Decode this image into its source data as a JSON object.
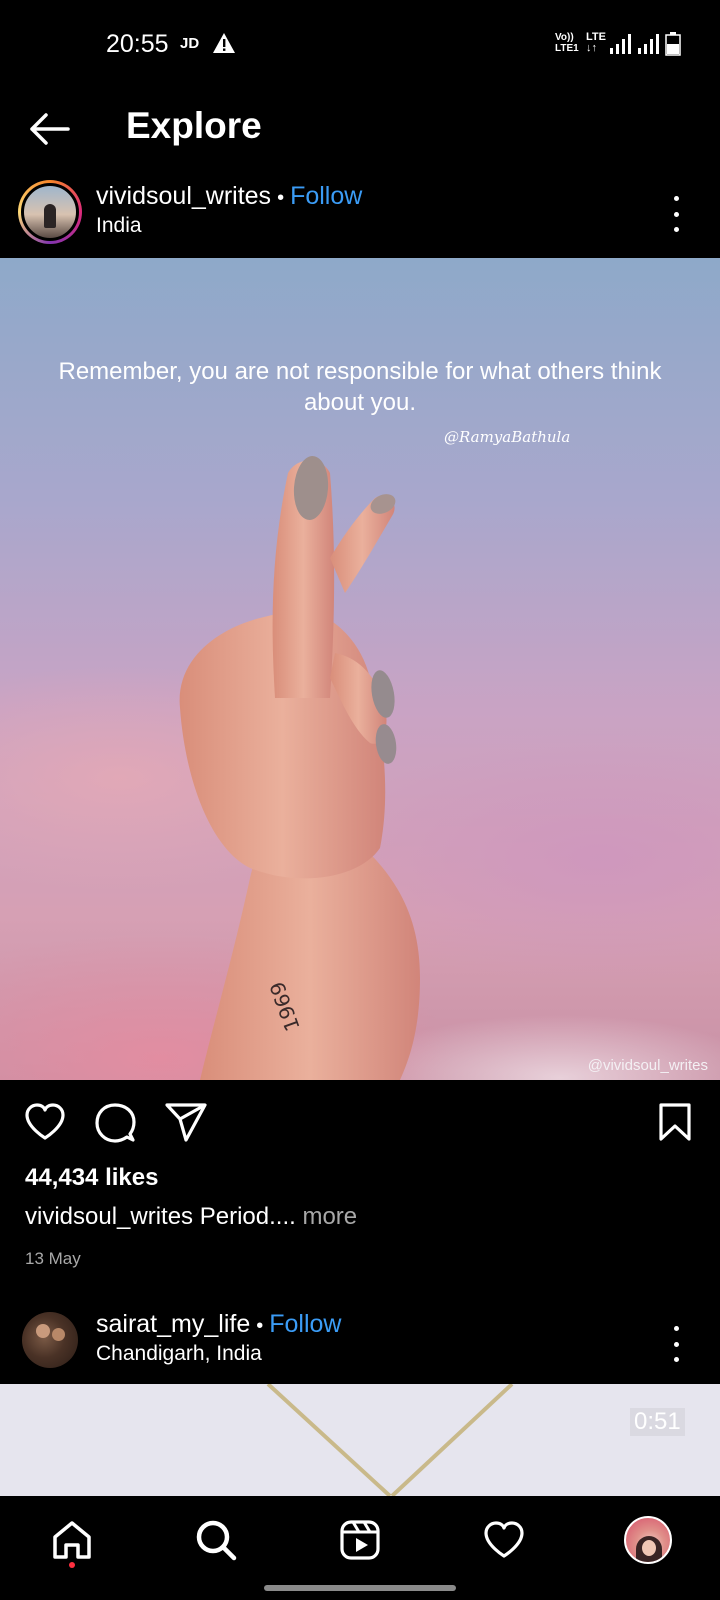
{
  "status_bar": {
    "time": "20:55",
    "carrier_tag": "JD",
    "volte_top": "Vo))",
    "volte_bottom": "LTE1",
    "network_top": "LTE",
    "network_bottom": "↓↑"
  },
  "header": {
    "title": "Explore"
  },
  "post1": {
    "username": "vividsoul_writes",
    "separator": "•",
    "follow_label": "Follow",
    "location": "India",
    "quote": "Remember, you are not responsible for what others think about you.",
    "signature": "@RamyaBathula",
    "tattoo": "1969",
    "watermark": "@vividsoul_writes",
    "likes": "44,434 likes",
    "caption_user": "vividsoul_writes",
    "caption_text": "Period....",
    "caption_more": "more",
    "date": "13 May"
  },
  "post2": {
    "username": "sairat_my_life",
    "separator": "•",
    "follow_label": "Follow",
    "location": "Chandigarh, India",
    "video_duration": "0:51"
  },
  "colors": {
    "background": "#000000",
    "accent_follow": "#3b9cf6",
    "secondary_text": "#a8a8a8",
    "notification_dot": "#ff3040"
  },
  "icons": [
    "back-arrow-icon",
    "more-vertical-icon",
    "heart-icon",
    "comment-icon",
    "share-icon",
    "bookmark-icon",
    "home-icon",
    "search-icon",
    "reels-icon",
    "activity-heart-icon",
    "profile-avatar"
  ]
}
